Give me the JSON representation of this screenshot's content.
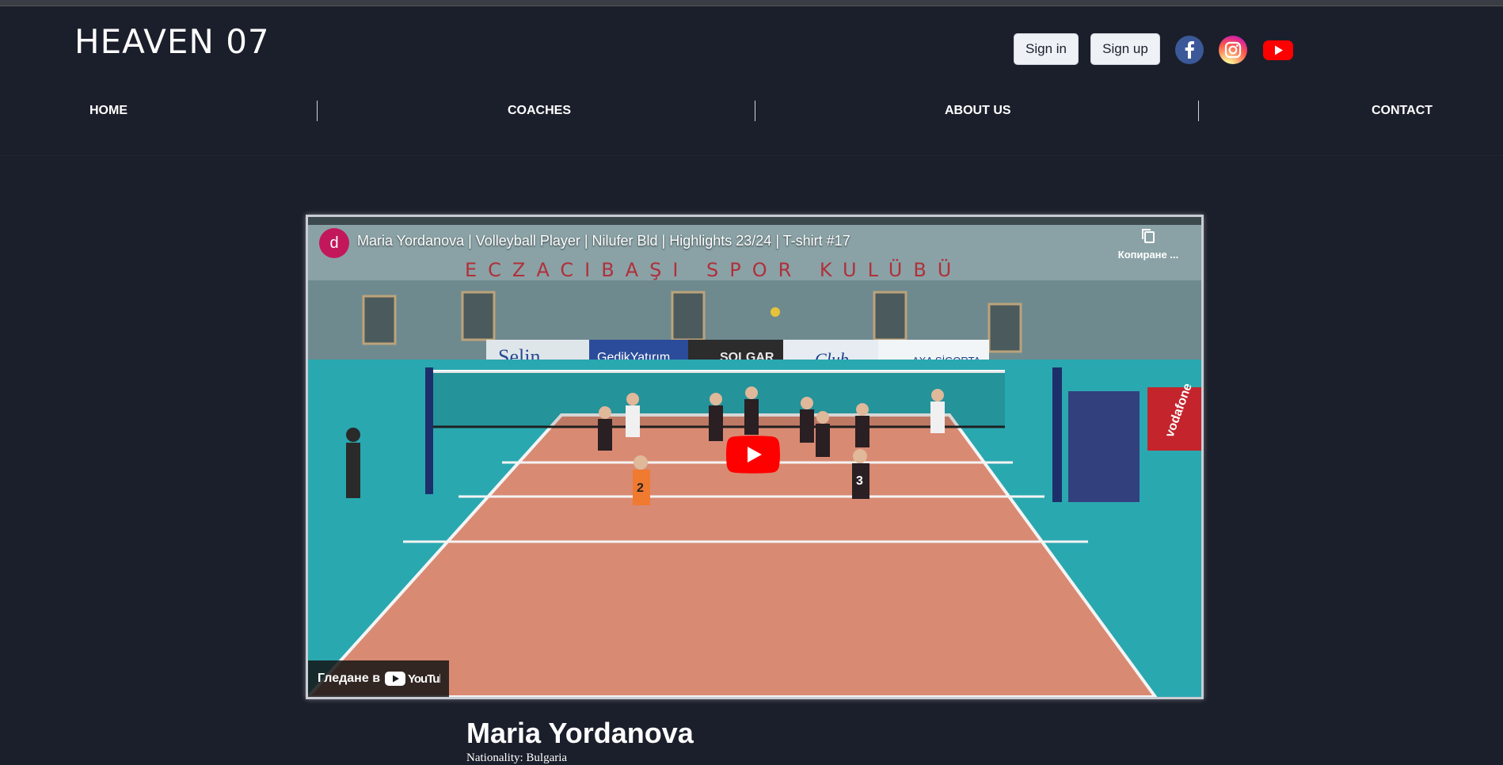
{
  "header": {
    "logo": "HEAVEN 07",
    "signin_label": "Sign in",
    "signup_label": "Sign up",
    "social": [
      "facebook-icon",
      "instagram-icon",
      "youtube-icon"
    ]
  },
  "nav": {
    "items": [
      {
        "label": "HOME"
      },
      {
        "label": "COACHES"
      },
      {
        "label": "ABOUT US"
      },
      {
        "label": "CONTACT"
      }
    ]
  },
  "video": {
    "channel_initial": "d",
    "title": "Maria Yordanova | Volleyball Player | Nilufer Bld | Highlights 23/24 | T-shirt #17",
    "copy_label": "Копиране ...",
    "watch_label": "Гледане в",
    "platform": "YouTube",
    "banner_text": "ECZACIBAŞI SPOR KULÜBÜ",
    "sponsors": [
      "Selin",
      "GedikYatırım",
      "SOLGAR",
      "Club",
      "AXA SİGORTA",
      "vodafone"
    ],
    "jersey_numbers": [
      "2",
      "3"
    ]
  },
  "player": {
    "name": "Maria Yordanova",
    "nationality": "Nationality: Bulgaria"
  },
  "colors": {
    "background": "#1b1f2b",
    "button_bg": "#eef1f6",
    "youtube_red": "#ff0000",
    "facebook_blue": "#3b5998",
    "court_orange": "#d98a73",
    "court_teal": "#2aa8b0"
  }
}
